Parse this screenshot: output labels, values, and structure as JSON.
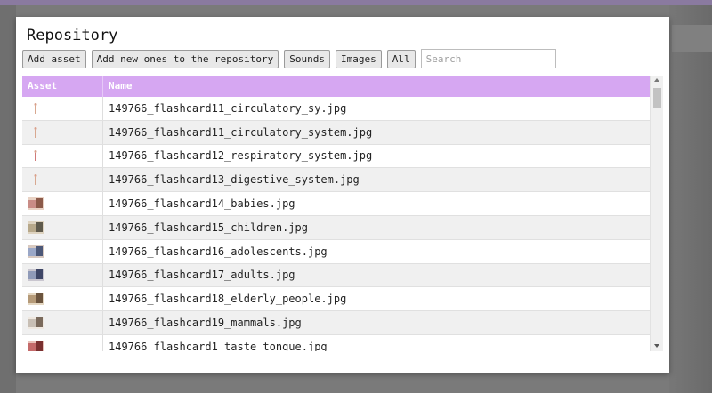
{
  "dialog": {
    "title": "Repository",
    "toolbar": {
      "add_asset": "Add asset",
      "add_new": "Add new ones to the repository",
      "sounds": "Sounds",
      "images": "Images",
      "all": "All",
      "search_placeholder": "Search",
      "search_value": ""
    },
    "table": {
      "headers": {
        "asset": "Asset",
        "name": "Name"
      },
      "rows": [
        {
          "thumb": "figure-icon",
          "name": "149766_flashcard11_circulatory_sy.jpg"
        },
        {
          "thumb": "figure-icon",
          "name": "149766_flashcard11_circulatory_system.jpg"
        },
        {
          "thumb": "figure-icon",
          "name": "149766_flashcard12_respiratory_system.jpg"
        },
        {
          "thumb": "figure-icon",
          "name": "149766_flashcard13_digestive_system.jpg"
        },
        {
          "thumb": "photo-icon",
          "name": "149766_flashcard14_babies.jpg"
        },
        {
          "thumb": "photo-icon",
          "name": "149766_flashcard15_children.jpg"
        },
        {
          "thumb": "photo-icon",
          "name": "149766_flashcard16_adolescents.jpg"
        },
        {
          "thumb": "photo-icon",
          "name": "149766_flashcard17_adults.jpg"
        },
        {
          "thumb": "photo-icon",
          "name": "149766_flashcard18_elderly_people.jpg"
        },
        {
          "thumb": "photo-icon",
          "name": "149766_flashcard19_mammals.jpg"
        },
        {
          "thumb": "photo-icon",
          "name": "149766_flashcard1_taste_tongue.jpg"
        }
      ]
    }
  },
  "colors": {
    "header_bg": "#d6a7f2",
    "top_bar": "#8a7aa0",
    "backdrop": "#7a7a7a"
  }
}
